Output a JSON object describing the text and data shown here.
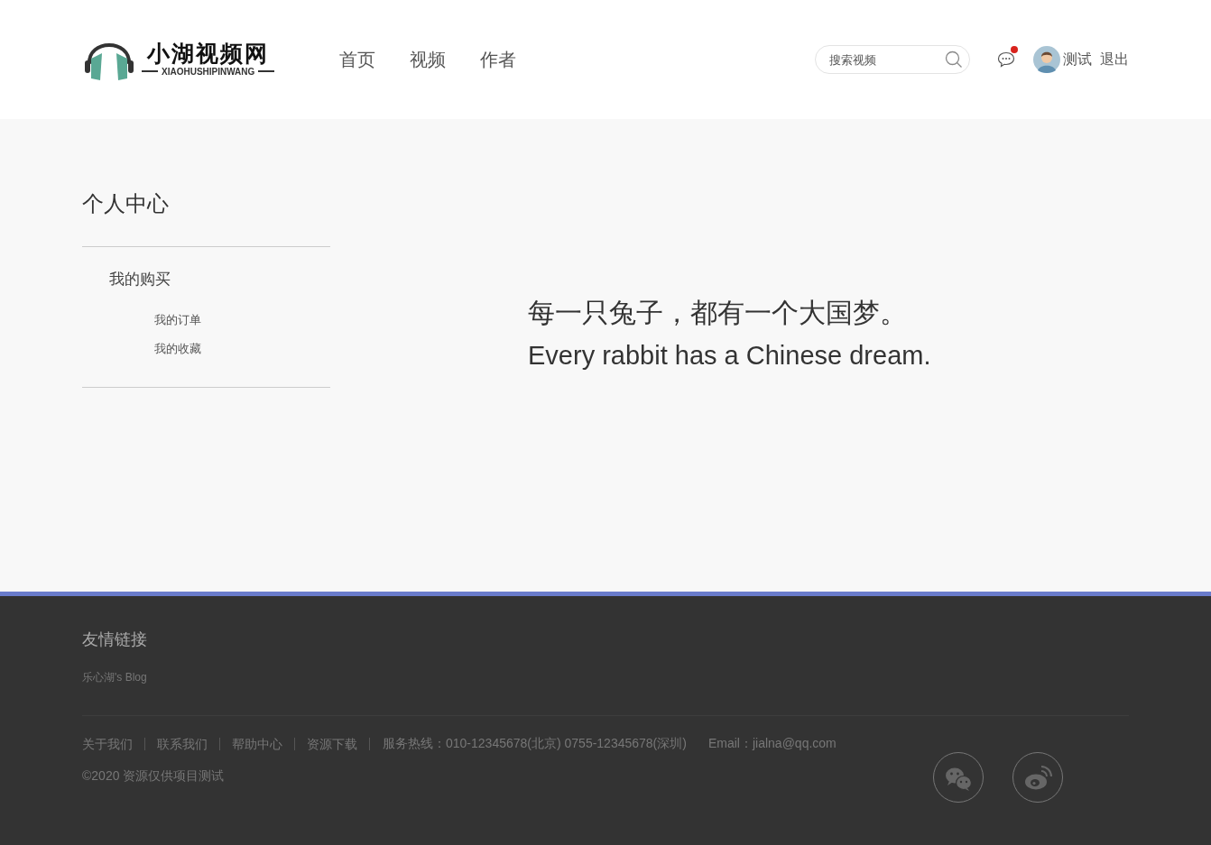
{
  "header": {
    "logo": {
      "title": "小湖视频网",
      "subtitle": "XIAOHUSHIPINWANG"
    },
    "nav": [
      {
        "label": "首页"
      },
      {
        "label": "视频"
      },
      {
        "label": "作者"
      }
    ],
    "search": {
      "placeholder": "搜索视频"
    },
    "messages": {
      "unread": true
    },
    "user": {
      "name": "测试",
      "logout": "退出"
    }
  },
  "sidebar": {
    "title": "个人中心",
    "groups": [
      {
        "label": "我的购买",
        "items": [
          {
            "label": "我的订单"
          },
          {
            "label": "我的收藏"
          }
        ]
      }
    ]
  },
  "hero": {
    "headline": "每一只兔子，都有一个大国梦。",
    "subline": "Every rabbit has a Chinese dream."
  },
  "footer": {
    "links_title": "友情链接",
    "friend_links": [
      "乐心湖's Blog"
    ],
    "nav": [
      "关于我们",
      "联系我们",
      "帮助中心",
      "资源下载"
    ],
    "hotline": "服务热线：010-12345678(北京) 0755-12345678(深圳)",
    "email": "Email：jialna@qq.com",
    "copyright": "©2020 资源仅供项目测试",
    "social": [
      {
        "kind": "wechat"
      },
      {
        "kind": "weibo"
      }
    ]
  }
}
